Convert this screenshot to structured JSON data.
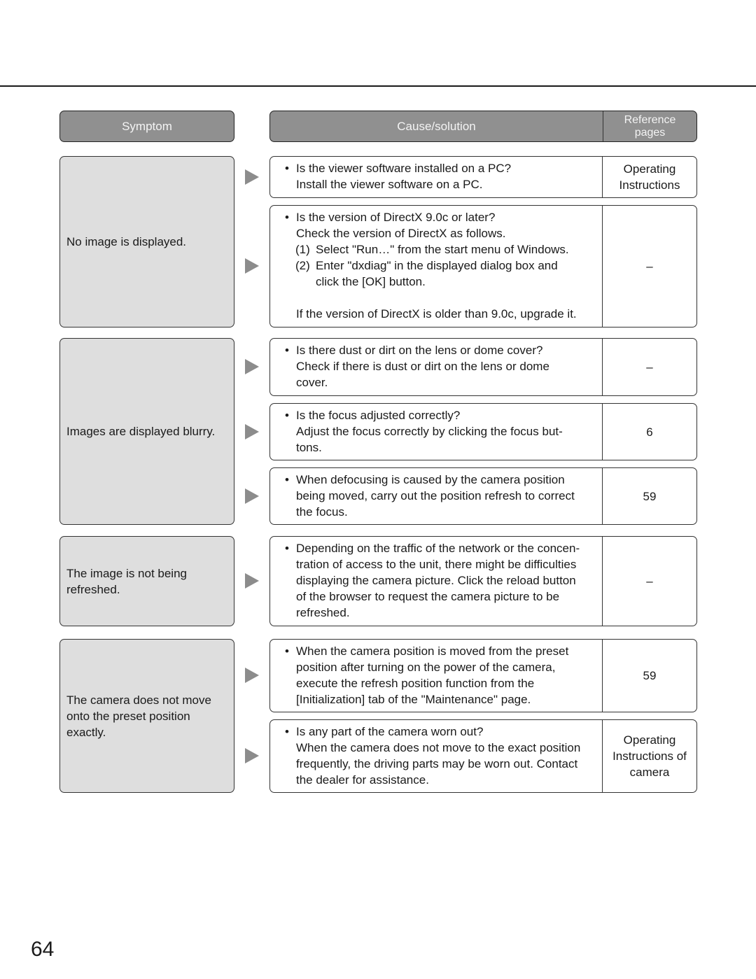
{
  "page_number": "64",
  "header": {
    "symptom_label": "Symptom",
    "cause_label": "Cause/solution",
    "reference_label_line1": "Reference",
    "reference_label_line2": "pages"
  },
  "symptoms": [
    {
      "text_lines": [
        "No image is displayed."
      ]
    },
    {
      "text_lines": [
        "Images are displayed blurry."
      ]
    },
    {
      "text_lines": [
        "The image is not being",
        "refreshed."
      ]
    },
    {
      "text_lines": [
        "The camera does not move",
        "onto the preset position",
        "exactly."
      ]
    }
  ],
  "causes": [
    {
      "bullet": "•",
      "lines": [
        "Is the viewer software installed on a PC?",
        "Install the viewer software on a PC."
      ],
      "reference_lines": [
        "Operating",
        "Instructions"
      ]
    },
    {
      "bullet": "•",
      "lines": [
        "Is the version of DirectX 9.0c or later?",
        "Check the version of DirectX as follows."
      ],
      "steps": [
        {
          "num": "(1)",
          "lines": [
            "Select \"Run…\" from the start menu of Windows."
          ]
        },
        {
          "num": "(2)",
          "lines": [
            "Enter \"dxdiag\" in the displayed dialog box and",
            "click the [OK] button."
          ]
        }
      ],
      "after_lines": [
        "If the version of DirectX is older than 9.0c, upgrade it."
      ],
      "reference_lines": [
        "–"
      ]
    },
    {
      "bullet": "•",
      "lines": [
        "Is there dust or dirt on the lens or dome cover?",
        "Check if there is dust or dirt on the lens or dome",
        "cover."
      ],
      "reference_lines": [
        "–"
      ]
    },
    {
      "bullet": "•",
      "lines": [
        "Is the focus adjusted correctly?",
        "Adjust the focus correctly by clicking the focus but-",
        "tons."
      ],
      "reference_lines": [
        "6"
      ]
    },
    {
      "bullet": "•",
      "lines": [
        "When defocusing is caused by the camera position",
        "being moved, carry out the position refresh to correct",
        "the focus."
      ],
      "reference_lines": [
        "59"
      ]
    },
    {
      "bullet": "•",
      "lines": [
        "Depending on the traffic of the network or the concen-",
        "tration of access to the unit, there might be difficulties",
        "displaying the camera picture. Click the reload button",
        "of the browser to request the camera picture to be",
        "refreshed."
      ],
      "reference_lines": [
        "–"
      ]
    },
    {
      "bullet": "•",
      "lines": [
        "When the camera position is moved from the preset",
        "position after turning on the power of the camera,",
        "execute the refresh position function from the",
        "[Initialization] tab of the \"Maintenance\" page."
      ],
      "reference_lines": [
        "59"
      ]
    },
    {
      "bullet": "•",
      "lines": [
        "Is any part of the camera worn out?",
        "When the camera does not move to the exact position",
        "frequently, the driving parts may be worn out. Contact",
        "the dealer for assistance."
      ],
      "reference_lines": [
        "Operating",
        "Instructions of",
        "camera"
      ]
    }
  ],
  "icons": {
    "arrow": "arrow-right-icon"
  }
}
